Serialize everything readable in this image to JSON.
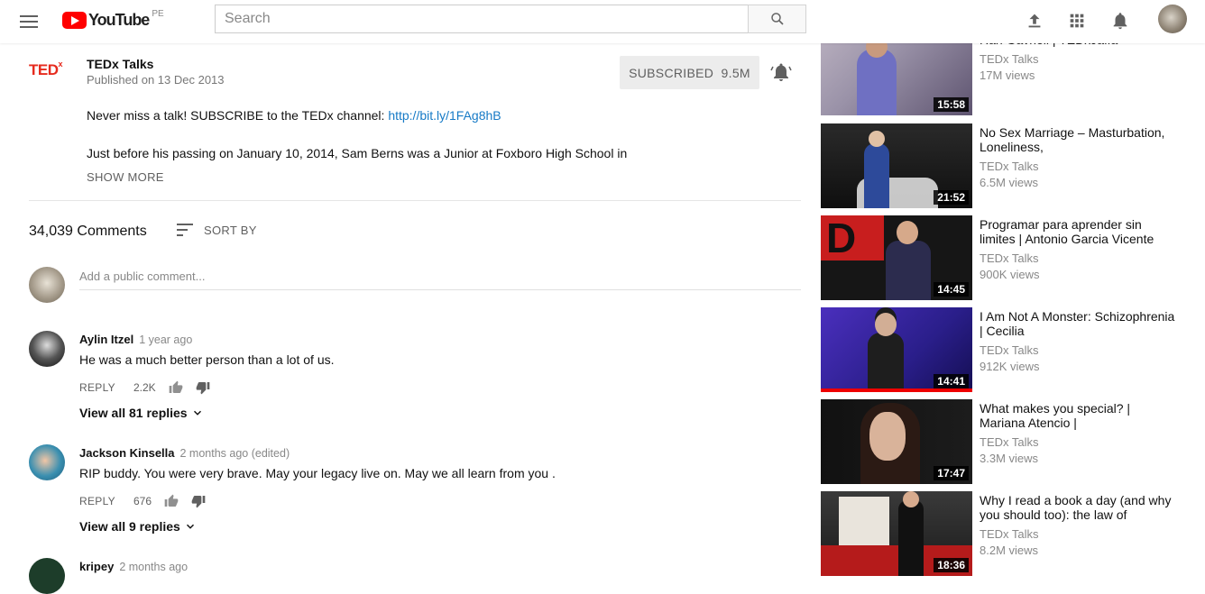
{
  "header": {
    "logo_text": "YouTube",
    "country": "PE",
    "search_placeholder": "Search"
  },
  "channel": {
    "logo_text": "TED",
    "logo_sup": "x",
    "name": "TEDx Talks",
    "published": "Published on 13 Dec 2013",
    "subscribe_label": "SUBSCRIBED",
    "subscriber_count": "9.5M"
  },
  "description": {
    "line1": "Never miss a talk! SUBSCRIBE to the TEDx channel: ",
    "link": "http://bit.ly/1FAg8hB",
    "line2": "Just before his passing on January 10, 2014, Sam Berns was a Junior at Foxboro High School in",
    "show_more": "SHOW MORE"
  },
  "comments": {
    "count": "34,039 Comments",
    "sort_label": "SORT BY",
    "add_placeholder": "Add a public comment...",
    "items": [
      {
        "author": "Aylin Itzel",
        "time": "1 year ago",
        "text": "He was a much better person than a lot of us.",
        "reply_label": "REPLY",
        "likes": "2.2K",
        "replies": "View all 81 replies"
      },
      {
        "author": "Jackson Kinsella",
        "time": "2 months ago (edited)",
        "text": "RIP buddy. You were very brave. May your legacy live on. May we all learn from you .",
        "reply_label": "REPLY",
        "likes": "676",
        "replies": "View all 9 replies"
      },
      {
        "author": "kripey",
        "time": "2 months ago"
      }
    ]
  },
  "recommendations": [
    {
      "title": "Ran Gavrieli | TEDxJaffa",
      "channel": "TEDx Talks",
      "views": "17M views",
      "duration": "15:58"
    },
    {
      "title": "No Sex Marriage – Masturbation, Loneliness,",
      "channel": "TEDx Talks",
      "views": "6.5M views",
      "duration": "21:52"
    },
    {
      "title": "Programar para aprender sin limites | Antonio Garcia Vicente",
      "channel": "TEDx Talks",
      "views": "900K views",
      "duration": "14:45"
    },
    {
      "title": "I Am Not A Monster: Schizophrenia | Cecilia",
      "channel": "TEDx Talks",
      "views": "912K views",
      "duration": "14:41"
    },
    {
      "title": "What makes you special? | Mariana Atencio |",
      "channel": "TEDx Talks",
      "views": "3.3M views",
      "duration": "17:47"
    },
    {
      "title": "Why I read a book a day (and why you should too): the law of",
      "channel": "TEDx Talks",
      "views": "8.2M views",
      "duration": "18:36"
    }
  ]
}
